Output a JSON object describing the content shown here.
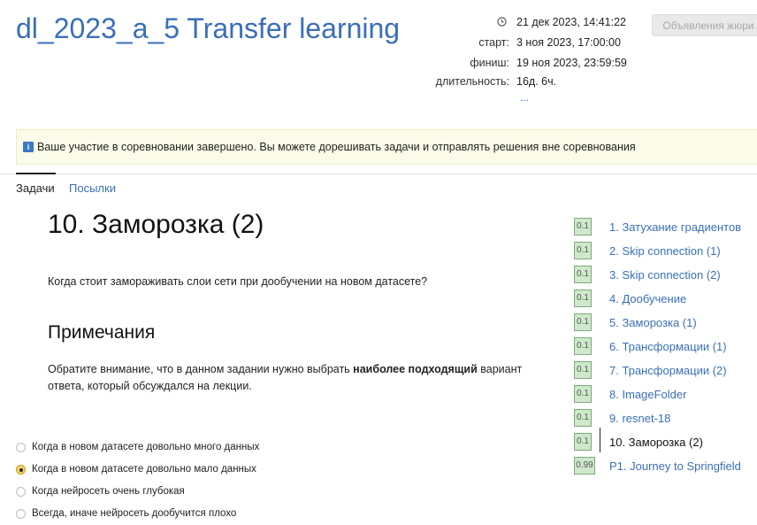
{
  "header": {
    "title": "dl_2023_a_5 Transfer learning",
    "clock_icon": "clock-icon",
    "current_time": "21 дек 2023, 14:41:22",
    "start_label": "старт:",
    "start_value": "3 ноя 2023, 17:00:00",
    "finish_label": "финиш:",
    "finish_value": "19 ноя 2023, 23:59:59",
    "duration_label": "длительность:",
    "duration_value": "16д. 6ч.",
    "more_link": "...",
    "jury_button": "Объявления жюри"
  },
  "notice": {
    "icon": "info-icon",
    "text": "Ваше участие в соревновании завершено. Вы можете дорешивать задачи и отправлять решения вне соревнования"
  },
  "tabs": [
    {
      "label": "Задачи",
      "active": true
    },
    {
      "label": "Посылки",
      "active": false
    }
  ],
  "problem": {
    "title": "10. Заморозка (2)",
    "question": "Когда стоит замораживать слои сети при дообучении на новом датасете?",
    "notes_title": "Примечания",
    "notes_before": "Обратите внимание, что в данном задании нужно выбрать ",
    "notes_bold": "наиболее подходящий",
    "notes_after": " вариант ответа, который обсуждался на лекции."
  },
  "options": [
    {
      "label": "Когда в новом датасете довольно много данных",
      "checked": false
    },
    {
      "label": "Когда в новом датасете довольно мало данных",
      "checked": true
    },
    {
      "label": "Когда нейросеть очень глубокая",
      "checked": false
    },
    {
      "label": "Всегда, иначе нейросеть дообучится плохо",
      "checked": false
    }
  ],
  "problems": [
    {
      "score": "0.1",
      "name": "1. Затухание градиентов"
    },
    {
      "score": "0.1",
      "name": "2. Skip connection (1)"
    },
    {
      "score": "0.1",
      "name": "3. Skip connection (2)"
    },
    {
      "score": "0.1",
      "name": "4. Дообучение"
    },
    {
      "score": "0.1",
      "name": "5. Заморозка (1)"
    },
    {
      "score": "0.1",
      "name": "6. Трансформации (1)"
    },
    {
      "score": "0.1",
      "name": "7. Трансформации (2)"
    },
    {
      "score": "0.1",
      "name": "8. ImageFolder"
    },
    {
      "score": "0.1",
      "name": "9. resnet-18"
    },
    {
      "score": "0.1",
      "name": "10. Заморозка (2)",
      "current": true
    },
    {
      "score": "0.99",
      "name": "P1. Journey to Springfield"
    }
  ],
  "colors": {
    "link": "#3a6fb8",
    "score_bg": "#cfe8cc",
    "notice_bg": "#fbfbe9",
    "radio_checked": "#f7d560"
  }
}
